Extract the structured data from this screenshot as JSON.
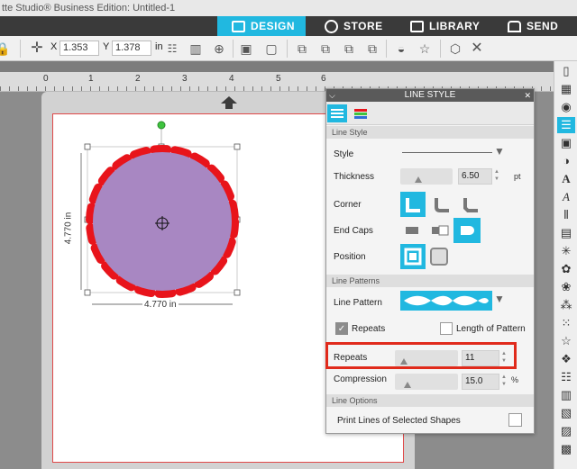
{
  "app": {
    "title": "tte Studio® Business Edition: Untitled-1"
  },
  "nav": {
    "tabs": [
      {
        "label": "DESIGN",
        "icon": "grid-icon",
        "active": true
      },
      {
        "label": "STORE",
        "icon": "silhouette-s-icon",
        "active": false
      },
      {
        "label": "LIBRARY",
        "icon": "library-download-icon",
        "active": false
      },
      {
        "label": "SEND",
        "icon": "cutter-icon",
        "active": false
      }
    ]
  },
  "toolbar": {
    "x_label": "X",
    "x_value": "1.353",
    "y_label": "Y",
    "y_value": "1.378",
    "unit": "in"
  },
  "ruler": {
    "numbers": [
      "0",
      "1",
      "2",
      "3",
      "4",
      "5",
      "6"
    ]
  },
  "shape": {
    "height_label": "4.770 in",
    "width_label": "4.770 in"
  },
  "panel": {
    "title": "LINE STYLE",
    "sections": {
      "line_style": "Line Style",
      "line_patterns": "Line Patterns",
      "line_options": "Line Options"
    },
    "style_label": "Style",
    "thickness_label": "Thickness",
    "thickness_value": "6.50",
    "thickness_unit": "pt",
    "corner_label": "Corner",
    "end_caps_label": "End Caps",
    "position_label": "Position",
    "line_pattern_label": "Line Pattern",
    "repeats_check_label": "Repeats",
    "length_check_label": "Length of Pattern",
    "repeats_label": "Repeats",
    "repeats_value": "11",
    "compression_label": "Compression",
    "compression_value": "15.0",
    "compression_unit": "%",
    "print_lines_label": "Print Lines of Selected Shapes"
  },
  "colors": {
    "accent": "#21b8e0",
    "shape_fill": "#a887c2",
    "shape_stroke": "#e8141b",
    "highlight": "#e02a1b"
  }
}
